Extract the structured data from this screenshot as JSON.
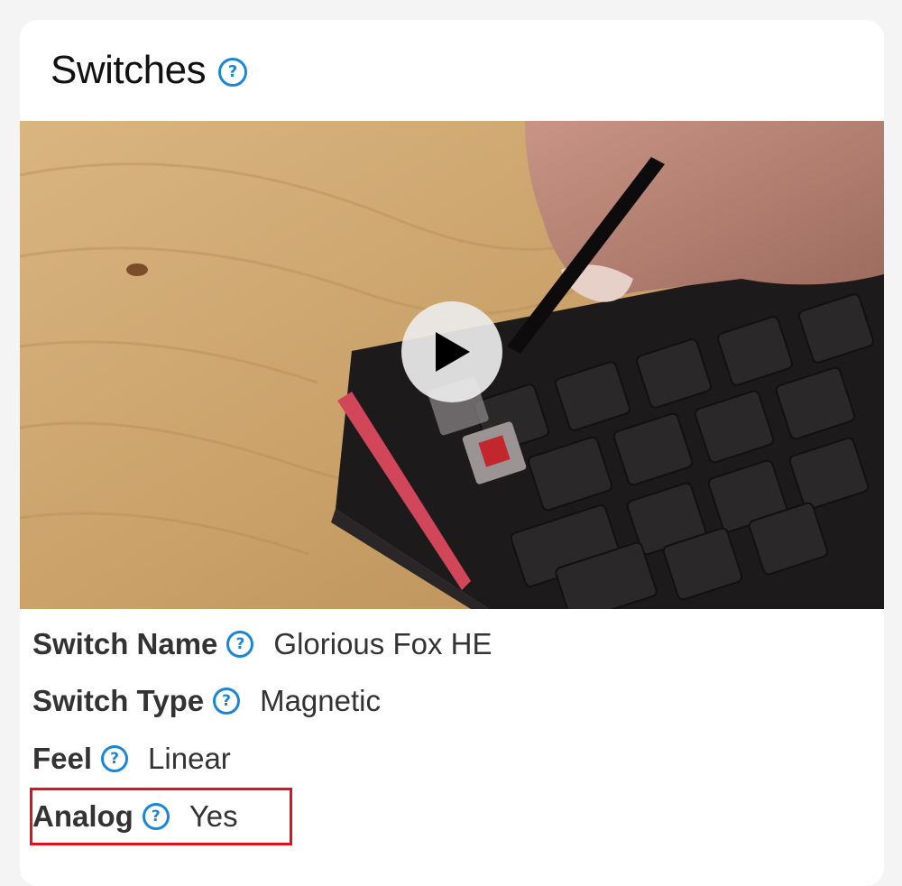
{
  "card": {
    "title": "Switches"
  },
  "video": {
    "play_label": "Play video"
  },
  "specs": [
    {
      "label": "Switch Name",
      "value": "Glorious Fox HE"
    },
    {
      "label": "Switch Type",
      "value": "Magnetic"
    },
    {
      "label": "Feel",
      "value": "Linear"
    },
    {
      "label": "Analog",
      "value": "Yes"
    }
  ],
  "colors": {
    "accent": "#1a86d8",
    "highlight": "#e0101e",
    "text": "#333333"
  },
  "icons": {
    "help": "question-circle-icon",
    "play": "play-icon"
  }
}
